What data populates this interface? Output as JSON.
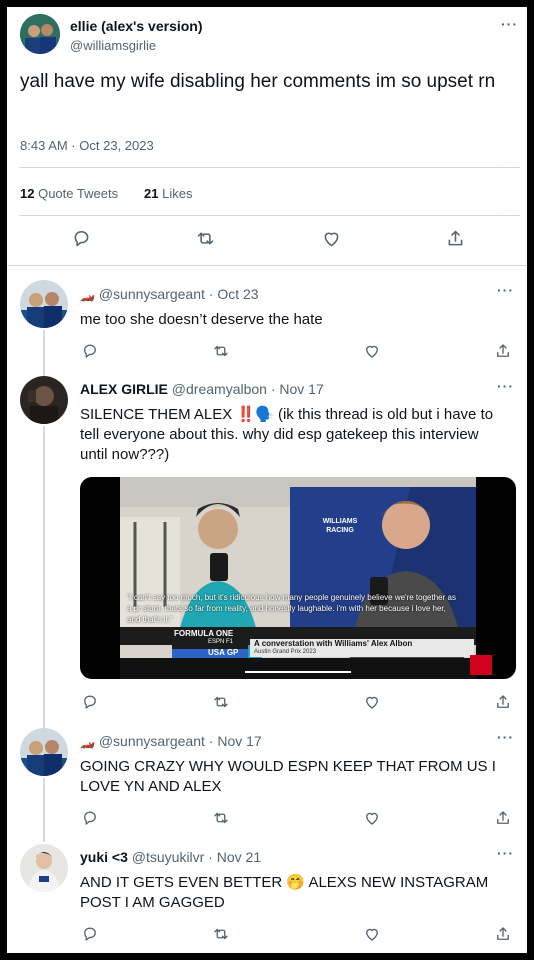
{
  "main": {
    "author_name": "ellie (alex's version)",
    "author_handle": "@williamsgirlie",
    "text": "yall have my wife disabling her comments im so upset rn",
    "timestamp": "8:43 AM · Oct 23, 2023",
    "quote_count": "12",
    "quote_label": "Quote Tweets",
    "like_count": "21",
    "like_label": "Likes"
  },
  "replies": [
    {
      "name": "",
      "emoji": "🏎️",
      "handle": "@sunnysargeant",
      "date": "· Oct 23",
      "text": "me too she doesn’t deserve the hate"
    },
    {
      "name": "ALEX GIRLIE",
      "handle": "@dreamyalbon",
      "date": "· Nov 17",
      "text": "SILENCE THEM ALEX ‼️🗣️ (ik this thread is old but i have to tell everyone about this. why did esp gatekeep this interview until now???)",
      "media": {
        "quote": "\"i can't say too much, but it's ridiculous how many people genuinely believe we're together as a pr stunt. thats so far from reality, and honestly laughable. i'm with her because i love her, and that's it.\"",
        "banner_label": "FORMULA ONE",
        "network": "ESPN F1",
        "event": "USA GP",
        "caption_title": "A converstation with Williams' Alex Albon",
        "caption_sub": "Austin Grand Prix 2023",
        "backdrop_text": "WILLIAMS RACING"
      }
    },
    {
      "name": "",
      "emoji": "🏎️",
      "handle": "@sunnysargeant",
      "date": "· Nov 17",
      "text": "GOING CRAZY WHY WOULD ESPN KEEP THAT FROM US I LOVE YN AND ALEX"
    },
    {
      "name": "yuki <3",
      "handle": "@tsuyukilvr",
      "date": "· Nov 21",
      "text": "AND IT GETS EVEN BETTER 🤭 ALEXS NEW INSTAGRAM POST I AM GAGGED"
    }
  ],
  "more_label": "···",
  "icons": [
    "reply-icon",
    "retweet-icon",
    "like-icon",
    "share-icon",
    "more-icon"
  ],
  "colors": {
    "text": "#0f1419",
    "secondary": "#536471",
    "divider": "#cfd9de",
    "espn_red": "#d0021b"
  }
}
